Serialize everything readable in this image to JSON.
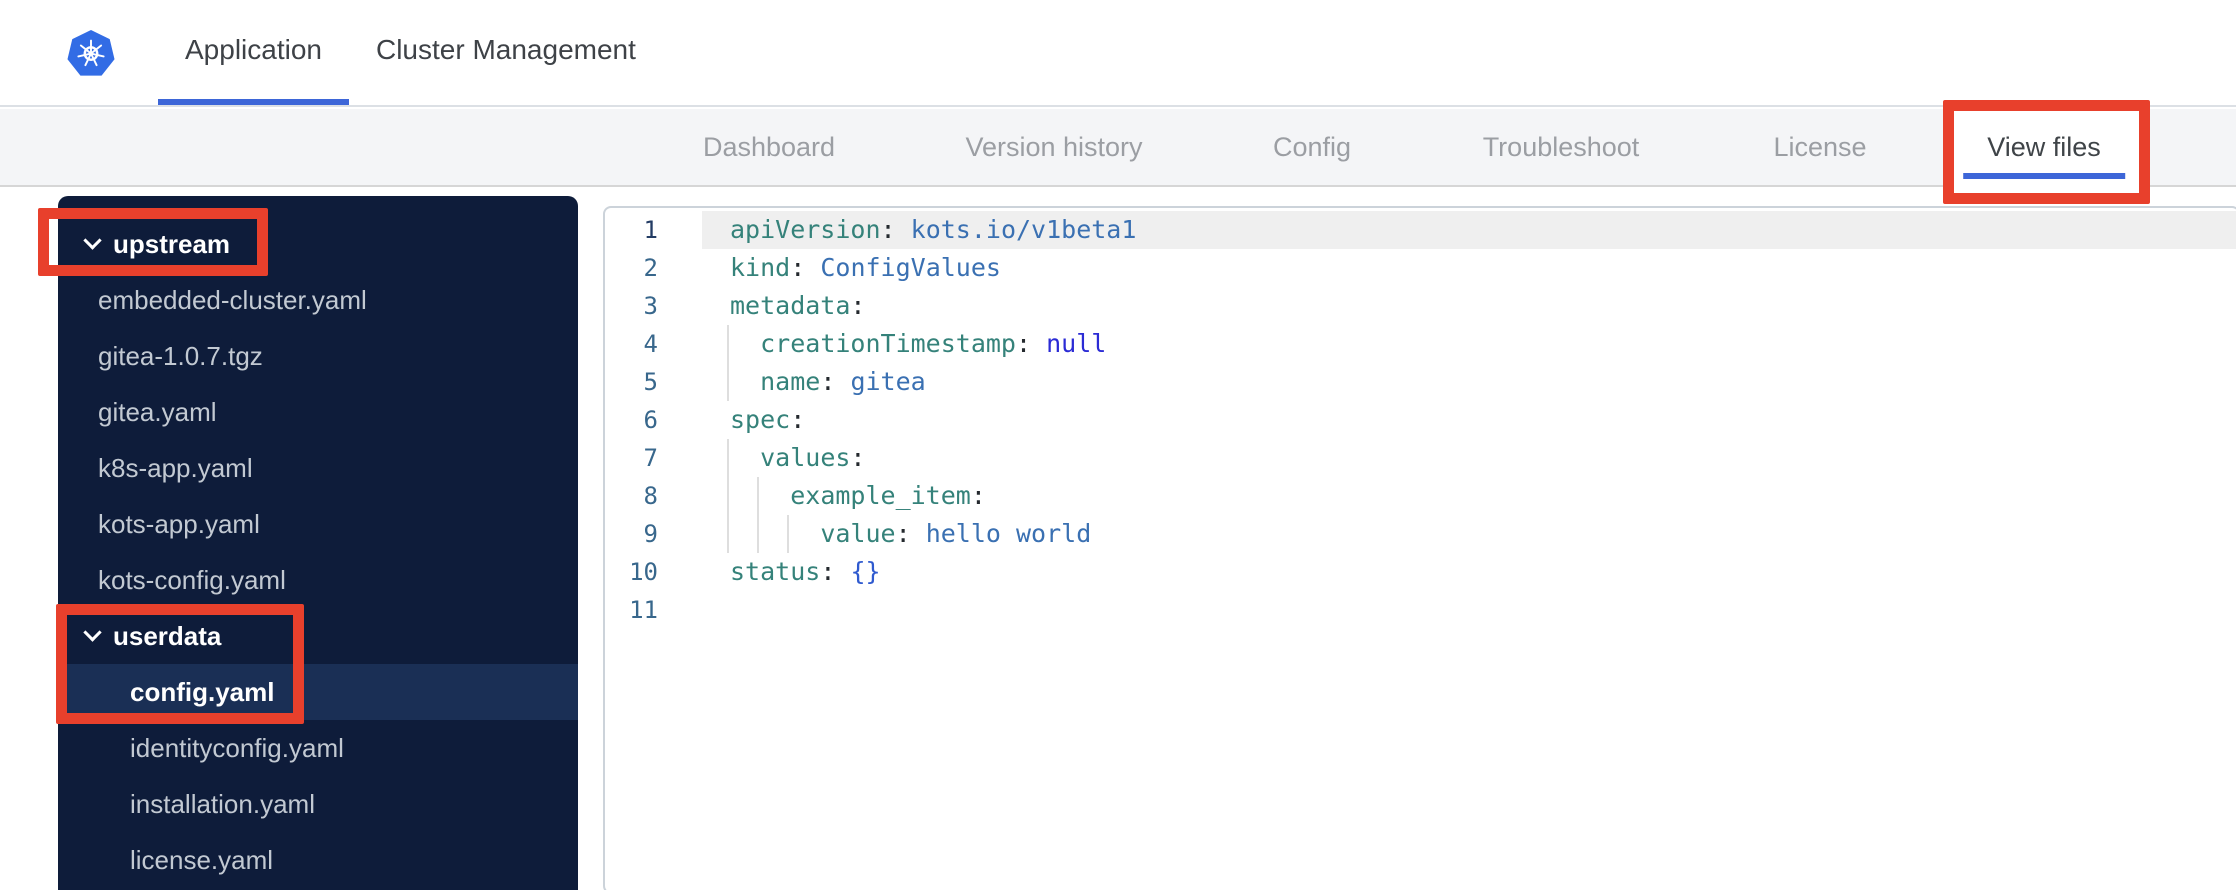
{
  "header": {
    "tabs": [
      {
        "label": "Application",
        "active": true
      },
      {
        "label": "Cluster Management",
        "active": false
      }
    ]
  },
  "nav": {
    "tabs": [
      {
        "label": "Dashboard",
        "active": false
      },
      {
        "label": "Version history",
        "active": false
      },
      {
        "label": "Config",
        "active": false
      },
      {
        "label": "Troubleshoot",
        "active": false
      },
      {
        "label": "License",
        "active": false
      },
      {
        "label": "View files",
        "active": true,
        "annotated": true
      }
    ]
  },
  "sidebar": {
    "items": [
      {
        "type": "folder",
        "label": "upstream",
        "expanded": true,
        "annotated": true
      },
      {
        "type": "file",
        "label": "embedded-cluster.yaml",
        "level": 1
      },
      {
        "type": "file",
        "label": "gitea-1.0.7.tgz",
        "level": 1
      },
      {
        "type": "file",
        "label": "gitea.yaml",
        "level": 1
      },
      {
        "type": "file",
        "label": "k8s-app.yaml",
        "level": 1
      },
      {
        "type": "file",
        "label": "kots-app.yaml",
        "level": 1
      },
      {
        "type": "file",
        "label": "kots-config.yaml",
        "level": 1
      },
      {
        "type": "folder",
        "label": "userdata",
        "expanded": true,
        "annotated": true
      },
      {
        "type": "file",
        "label": "config.yaml",
        "level": 2,
        "selected": true
      },
      {
        "type": "file",
        "label": "identityconfig.yaml",
        "level": 2
      },
      {
        "type": "file",
        "label": "installation.yaml",
        "level": 2
      },
      {
        "type": "file",
        "label": "license.yaml",
        "level": 2
      }
    ]
  },
  "editor": {
    "language": "yaml",
    "lines": [
      {
        "num": "1",
        "active": true,
        "guides": 0,
        "tokens": [
          [
            "key",
            "apiVersion"
          ],
          [
            "punc",
            ":"
          ],
          [
            "plain",
            " "
          ],
          [
            "value",
            "kots.io/v1beta1"
          ]
        ]
      },
      {
        "num": "2",
        "guides": 0,
        "tokens": [
          [
            "key",
            "kind"
          ],
          [
            "punc",
            ":"
          ],
          [
            "plain",
            " "
          ],
          [
            "value",
            "ConfigValues"
          ]
        ]
      },
      {
        "num": "3",
        "guides": 0,
        "tokens": [
          [
            "key",
            "metadata"
          ],
          [
            "punc",
            ":"
          ]
        ]
      },
      {
        "num": "4",
        "guides": 1,
        "tokens": [
          [
            "plain",
            "  "
          ],
          [
            "key",
            "creationTimestamp"
          ],
          [
            "punc",
            ":"
          ],
          [
            "plain",
            " "
          ],
          [
            "keyword",
            "null"
          ]
        ]
      },
      {
        "num": "5",
        "guides": 1,
        "tokens": [
          [
            "plain",
            "  "
          ],
          [
            "key",
            "name"
          ],
          [
            "punc",
            ":"
          ],
          [
            "plain",
            " "
          ],
          [
            "value",
            "gitea"
          ]
        ]
      },
      {
        "num": "6",
        "guides": 0,
        "tokens": [
          [
            "key",
            "spec"
          ],
          [
            "punc",
            ":"
          ]
        ]
      },
      {
        "num": "7",
        "guides": 1,
        "tokens": [
          [
            "plain",
            "  "
          ],
          [
            "key",
            "values"
          ],
          [
            "punc",
            ":"
          ]
        ]
      },
      {
        "num": "8",
        "guides": 2,
        "tokens": [
          [
            "plain",
            "    "
          ],
          [
            "key",
            "example_item"
          ],
          [
            "punc",
            ":"
          ]
        ]
      },
      {
        "num": "9",
        "guides": 3,
        "tokens": [
          [
            "plain",
            "      "
          ],
          [
            "key",
            "value"
          ],
          [
            "punc",
            ":"
          ],
          [
            "plain",
            " "
          ],
          [
            "value",
            "hello world"
          ]
        ]
      },
      {
        "num": "10",
        "guides": 0,
        "tokens": [
          [
            "key",
            "status"
          ],
          [
            "punc",
            ":"
          ],
          [
            "plain",
            " "
          ],
          [
            "brace",
            "{}"
          ]
        ]
      },
      {
        "num": "11",
        "guides": 0,
        "tokens": []
      }
    ]
  },
  "colors": {
    "kubernetes_blue": "#326CE5",
    "active_tab_underline": "#3D66D8",
    "annotation_red": "#E8402C",
    "nav_bg": "#F4F5F7",
    "sidebar_bg": "#0E1C3A",
    "sidebar_selected_bg": "#1A2F55",
    "syntax_key": "#35827A",
    "syntax_value": "#3A70B2",
    "syntax_null": "#2B2BD5",
    "syntax_brace": "#2F5ACF",
    "line_number": "#38678C",
    "line_number_active": "#233C64"
  }
}
